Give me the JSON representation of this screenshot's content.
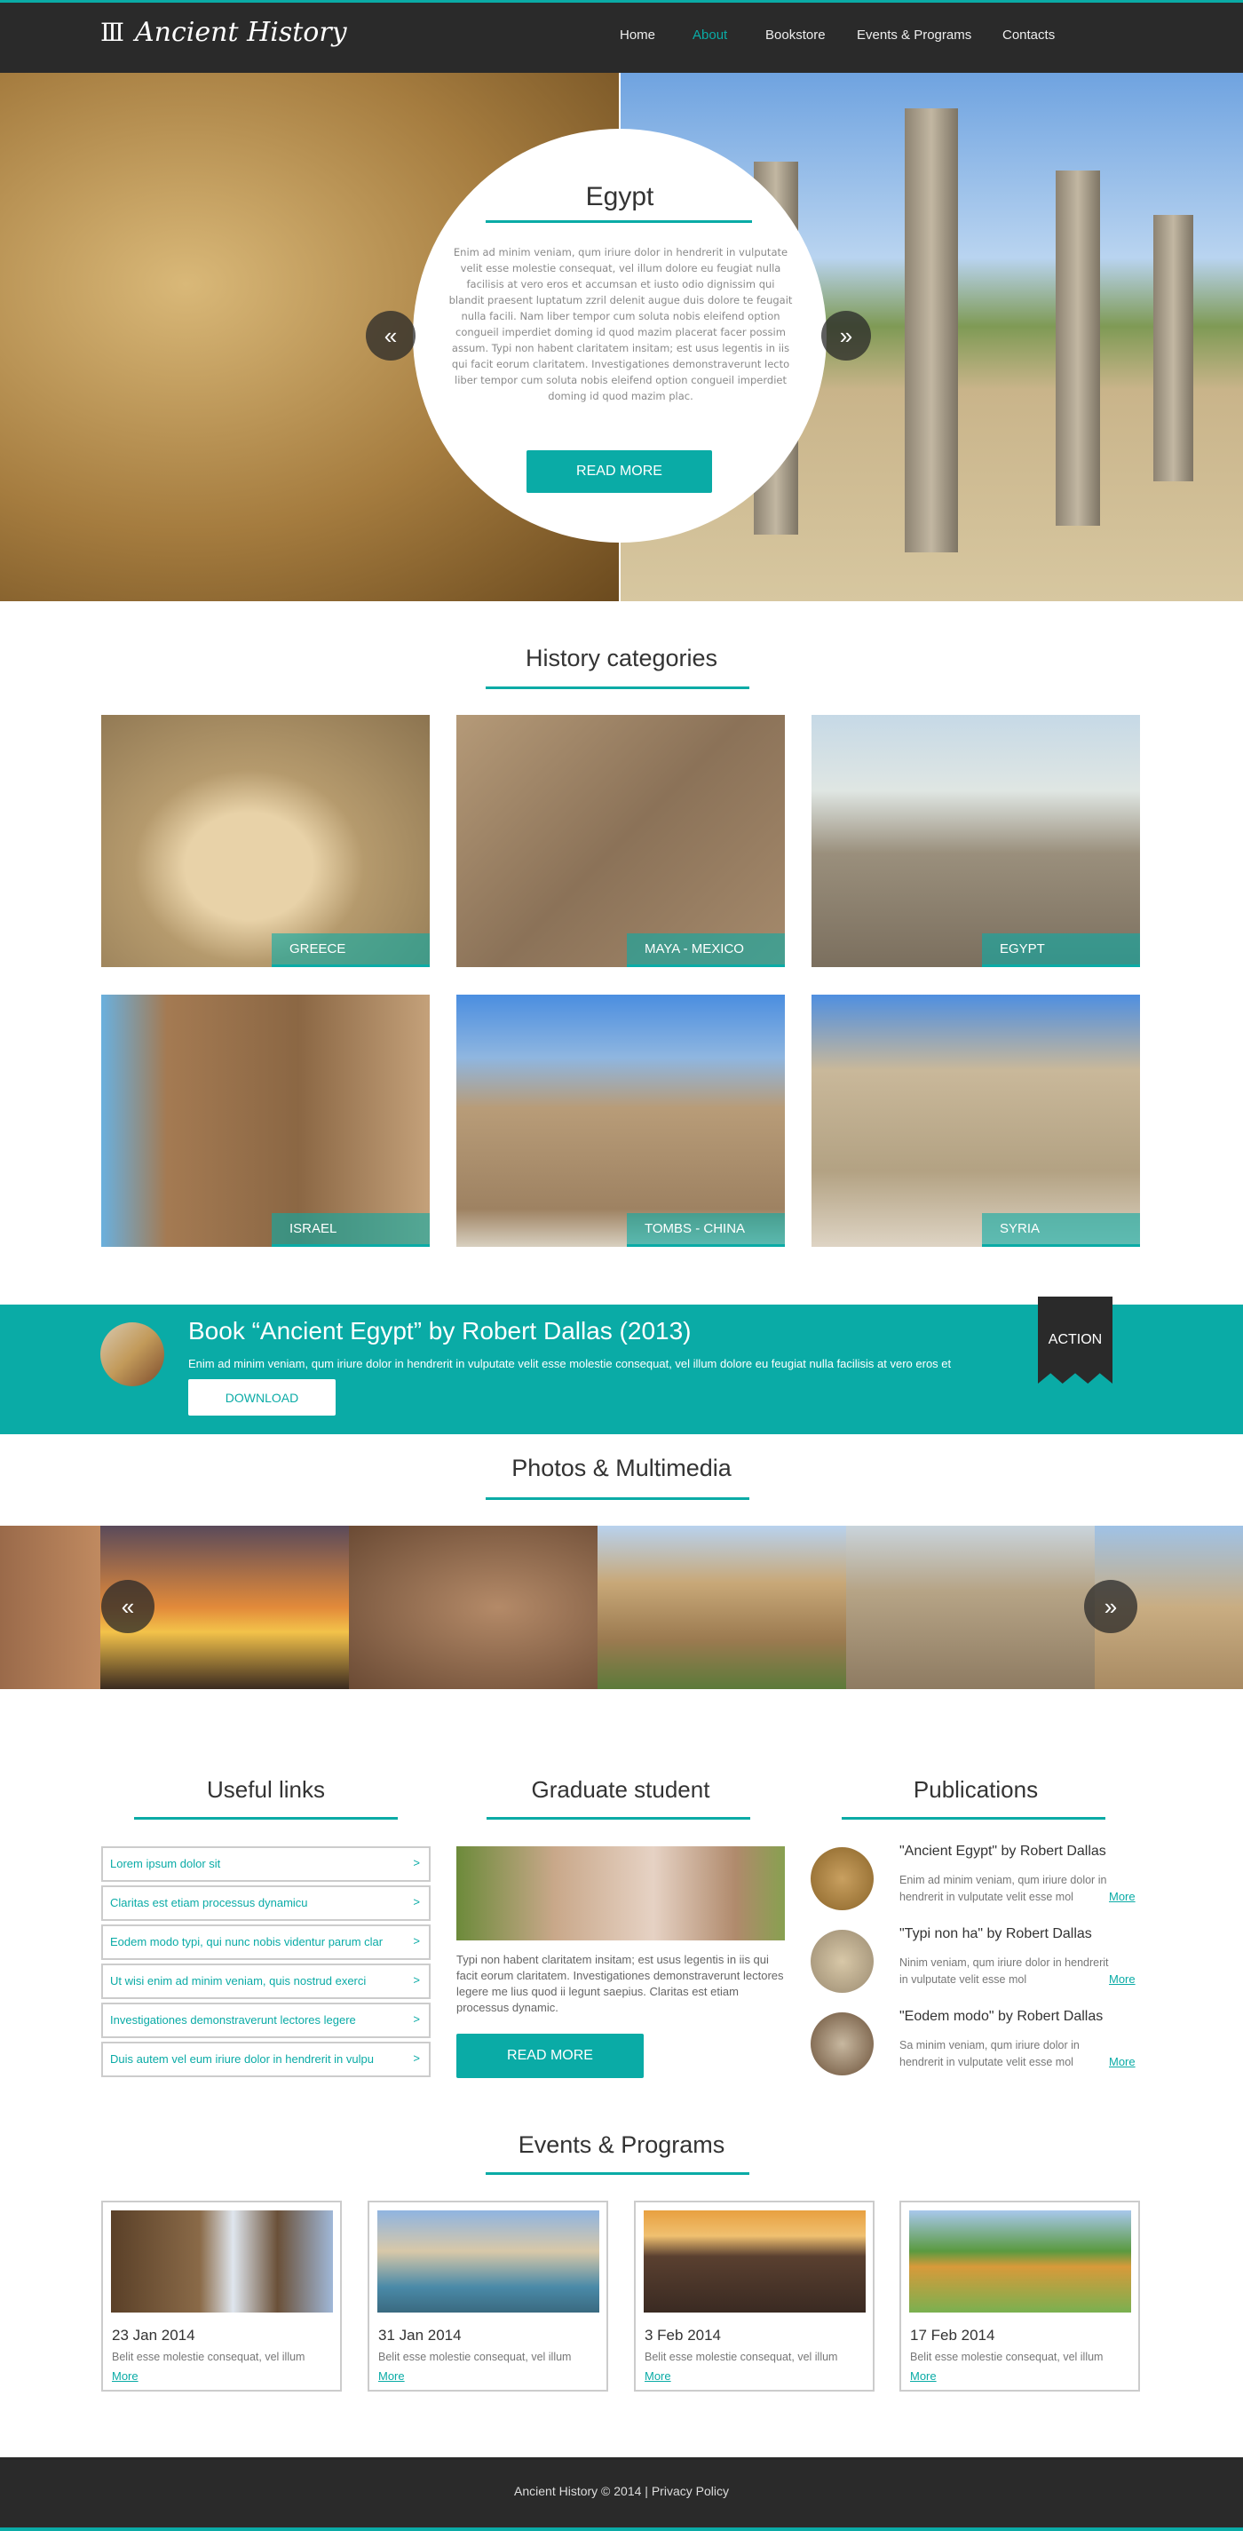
{
  "nav": {
    "logo": "Ancient History",
    "items": [
      {
        "label": "Home"
      },
      {
        "label": "About",
        "active": true
      },
      {
        "label": "Bookstore"
      },
      {
        "label": "Events & Programs"
      },
      {
        "label": "Contacts"
      }
    ]
  },
  "hero": {
    "title": "Egypt",
    "text": "Enim ad minim veniam, qum iriure dolor in hendrerit in vulputate velit esse molestie consequat, vel illum dolore eu feugiat nulla facilisis at vero eros et accumsan et iusto odio dignissim qui blandit praesent luptatum zzril delenit augue duis dolore te feugait nulla facili.  Nam liber tempor cum soluta nobis eleifend option congueil imperdiet doming id quod mazim placerat facer possim assum. Typi non habent claritatem insitam; est usus legentis in iis qui facit eorum claritatem. Investigationes demonstraverunt lecto liber tempor cum soluta nobis eleifend option congueil imperdiet doming id quod mazim plac.",
    "button": "READ MORE",
    "prev_icon": "double-arrow-left",
    "next_icon": "double-arrow-right"
  },
  "categories": {
    "title": "History categories",
    "items": [
      {
        "label": "GREECE"
      },
      {
        "label": "MAYA - MEXICO"
      },
      {
        "label": "EGYPT"
      },
      {
        "label": "ISRAEL"
      },
      {
        "label": "TOMBS - CHINA"
      },
      {
        "label": "SYRIA"
      }
    ]
  },
  "banner": {
    "title": "Book “Ancient Egypt” by Robert Dallas (2013)",
    "text": "Enim ad minim veniam, qum iriure dolor in hendrerit in vulputate velit esse molestie consequat, vel illum dolore eu feugiat nulla facilisis at vero eros et",
    "button": "DOWNLOAD",
    "ribbon": "ACTION"
  },
  "photos": {
    "title": "Photos & Multimedia"
  },
  "links": {
    "title": "Useful links",
    "items": [
      "Lorem ipsum dolor sit",
      "Claritas est etiam processus dynamicu",
      "Eodem modo typi, qui nunc nobis videntur parum clar",
      "Ut wisi enim ad minim veniam, quis nostrud exerci",
      "Investigationes demonstraverunt lectores legere",
      "Duis autem vel eum iriure dolor in hendrerit in vulpu"
    ],
    "chevron": ">"
  },
  "graduate": {
    "title": "Graduate student",
    "text": "Typi non habent claritatem insitam; est usus legentis in iis qui facit eorum claritatem. Investigationes demonstraverunt lectores legere me lius quod ii legunt saepius. Claritas est etiam processus dynamic.",
    "button": "READ MORE"
  },
  "publications": {
    "title": "Publications",
    "items": [
      {
        "title": "\"Ancient Egypt\" by Robert Dallas",
        "text": "Enim ad minim veniam, qum iriure dolor in hendrerit in vulputate velit esse mol",
        "more": "More"
      },
      {
        "title": "\"Typi non ha\" by Robert Dallas",
        "text": "Ninim veniam, qum iriure dolor in hendrerit in vulputate velit esse mol",
        "more": "More"
      },
      {
        "title": "\"Eodem modo\" by Robert Dallas",
        "text": "Sa minim veniam, qum iriure dolor in hendrerit in vulputate velit esse mol",
        "more": "More"
      }
    ]
  },
  "events": {
    "title": "Events & Programs",
    "items": [
      {
        "date": "23 Jan 2014",
        "text": "Belit esse molestie consequat, vel illum",
        "more": "More"
      },
      {
        "date": "31 Jan 2014",
        "text": "Belit esse molestie consequat, vel illum",
        "more": "More"
      },
      {
        "date": "3 Feb 2014",
        "text": "Belit esse molestie consequat, vel illum",
        "more": "More"
      },
      {
        "date": "17 Feb 2014",
        "text": "Belit esse molestie consequat, vel illum",
        "more": "More"
      }
    ]
  },
  "footer": {
    "copyright": "Ancient History © 2014",
    "separator": "|",
    "privacy": "Privacy Policy"
  },
  "colors": {
    "accent": "#0aaba6",
    "dark": "#2a2a2a"
  }
}
